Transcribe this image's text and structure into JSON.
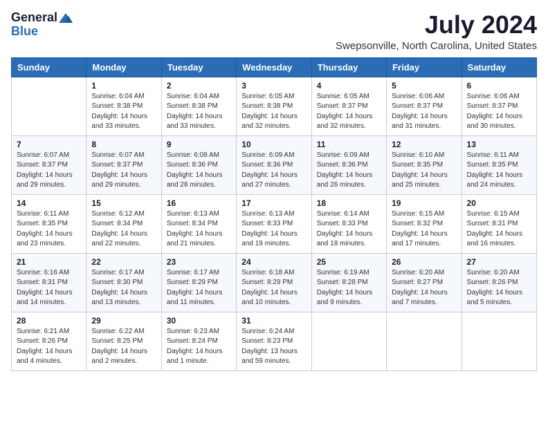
{
  "logo": {
    "general": "General",
    "blue": "Blue"
  },
  "title": "July 2024",
  "subtitle": "Swepsonville, North Carolina, United States",
  "headers": [
    "Sunday",
    "Monday",
    "Tuesday",
    "Wednesday",
    "Thursday",
    "Friday",
    "Saturday"
  ],
  "weeks": [
    [
      {
        "day": "",
        "sunrise": "",
        "sunset": "",
        "daylight": ""
      },
      {
        "day": "1",
        "sunrise": "Sunrise: 6:04 AM",
        "sunset": "Sunset: 8:38 PM",
        "daylight": "Daylight: 14 hours and 33 minutes."
      },
      {
        "day": "2",
        "sunrise": "Sunrise: 6:04 AM",
        "sunset": "Sunset: 8:38 PM",
        "daylight": "Daylight: 14 hours and 33 minutes."
      },
      {
        "day": "3",
        "sunrise": "Sunrise: 6:05 AM",
        "sunset": "Sunset: 8:38 PM",
        "daylight": "Daylight: 14 hours and 32 minutes."
      },
      {
        "day": "4",
        "sunrise": "Sunrise: 6:05 AM",
        "sunset": "Sunset: 8:37 PM",
        "daylight": "Daylight: 14 hours and 32 minutes."
      },
      {
        "day": "5",
        "sunrise": "Sunrise: 6:06 AM",
        "sunset": "Sunset: 8:37 PM",
        "daylight": "Daylight: 14 hours and 31 minutes."
      },
      {
        "day": "6",
        "sunrise": "Sunrise: 6:06 AM",
        "sunset": "Sunset: 8:37 PM",
        "daylight": "Daylight: 14 hours and 30 minutes."
      }
    ],
    [
      {
        "day": "7",
        "sunrise": "Sunrise: 6:07 AM",
        "sunset": "Sunset: 8:37 PM",
        "daylight": "Daylight: 14 hours and 29 minutes."
      },
      {
        "day": "8",
        "sunrise": "Sunrise: 6:07 AM",
        "sunset": "Sunset: 8:37 PM",
        "daylight": "Daylight: 14 hours and 29 minutes."
      },
      {
        "day": "9",
        "sunrise": "Sunrise: 6:08 AM",
        "sunset": "Sunset: 8:36 PM",
        "daylight": "Daylight: 14 hours and 28 minutes."
      },
      {
        "day": "10",
        "sunrise": "Sunrise: 6:09 AM",
        "sunset": "Sunset: 8:36 PM",
        "daylight": "Daylight: 14 hours and 27 minutes."
      },
      {
        "day": "11",
        "sunrise": "Sunrise: 6:09 AM",
        "sunset": "Sunset: 8:36 PM",
        "daylight": "Daylight: 14 hours and 26 minutes."
      },
      {
        "day": "12",
        "sunrise": "Sunrise: 6:10 AM",
        "sunset": "Sunset: 8:35 PM",
        "daylight": "Daylight: 14 hours and 25 minutes."
      },
      {
        "day": "13",
        "sunrise": "Sunrise: 6:11 AM",
        "sunset": "Sunset: 8:35 PM",
        "daylight": "Daylight: 14 hours and 24 minutes."
      }
    ],
    [
      {
        "day": "14",
        "sunrise": "Sunrise: 6:11 AM",
        "sunset": "Sunset: 8:35 PM",
        "daylight": "Daylight: 14 hours and 23 minutes."
      },
      {
        "day": "15",
        "sunrise": "Sunrise: 6:12 AM",
        "sunset": "Sunset: 8:34 PM",
        "daylight": "Daylight: 14 hours and 22 minutes."
      },
      {
        "day": "16",
        "sunrise": "Sunrise: 6:13 AM",
        "sunset": "Sunset: 8:34 PM",
        "daylight": "Daylight: 14 hours and 21 minutes."
      },
      {
        "day": "17",
        "sunrise": "Sunrise: 6:13 AM",
        "sunset": "Sunset: 8:33 PM",
        "daylight": "Daylight: 14 hours and 19 minutes."
      },
      {
        "day": "18",
        "sunrise": "Sunrise: 6:14 AM",
        "sunset": "Sunset: 8:33 PM",
        "daylight": "Daylight: 14 hours and 18 minutes."
      },
      {
        "day": "19",
        "sunrise": "Sunrise: 6:15 AM",
        "sunset": "Sunset: 8:32 PM",
        "daylight": "Daylight: 14 hours and 17 minutes."
      },
      {
        "day": "20",
        "sunrise": "Sunrise: 6:15 AM",
        "sunset": "Sunset: 8:31 PM",
        "daylight": "Daylight: 14 hours and 16 minutes."
      }
    ],
    [
      {
        "day": "21",
        "sunrise": "Sunrise: 6:16 AM",
        "sunset": "Sunset: 8:31 PM",
        "daylight": "Daylight: 14 hours and 14 minutes."
      },
      {
        "day": "22",
        "sunrise": "Sunrise: 6:17 AM",
        "sunset": "Sunset: 8:30 PM",
        "daylight": "Daylight: 14 hours and 13 minutes."
      },
      {
        "day": "23",
        "sunrise": "Sunrise: 6:17 AM",
        "sunset": "Sunset: 8:29 PM",
        "daylight": "Daylight: 14 hours and 11 minutes."
      },
      {
        "day": "24",
        "sunrise": "Sunrise: 6:18 AM",
        "sunset": "Sunset: 8:29 PM",
        "daylight": "Daylight: 14 hours and 10 minutes."
      },
      {
        "day": "25",
        "sunrise": "Sunrise: 6:19 AM",
        "sunset": "Sunset: 8:28 PM",
        "daylight": "Daylight: 14 hours and 9 minutes."
      },
      {
        "day": "26",
        "sunrise": "Sunrise: 6:20 AM",
        "sunset": "Sunset: 8:27 PM",
        "daylight": "Daylight: 14 hours and 7 minutes."
      },
      {
        "day": "27",
        "sunrise": "Sunrise: 6:20 AM",
        "sunset": "Sunset: 8:26 PM",
        "daylight": "Daylight: 14 hours and 5 minutes."
      }
    ],
    [
      {
        "day": "28",
        "sunrise": "Sunrise: 6:21 AM",
        "sunset": "Sunset: 8:26 PM",
        "daylight": "Daylight: 14 hours and 4 minutes."
      },
      {
        "day": "29",
        "sunrise": "Sunrise: 6:22 AM",
        "sunset": "Sunset: 8:25 PM",
        "daylight": "Daylight: 14 hours and 2 minutes."
      },
      {
        "day": "30",
        "sunrise": "Sunrise: 6:23 AM",
        "sunset": "Sunset: 8:24 PM",
        "daylight": "Daylight: 14 hours and 1 minute."
      },
      {
        "day": "31",
        "sunrise": "Sunrise: 6:24 AM",
        "sunset": "Sunset: 8:23 PM",
        "daylight": "Daylight: 13 hours and 59 minutes."
      },
      {
        "day": "",
        "sunrise": "",
        "sunset": "",
        "daylight": ""
      },
      {
        "day": "",
        "sunrise": "",
        "sunset": "",
        "daylight": ""
      },
      {
        "day": "",
        "sunrise": "",
        "sunset": "",
        "daylight": ""
      }
    ]
  ]
}
